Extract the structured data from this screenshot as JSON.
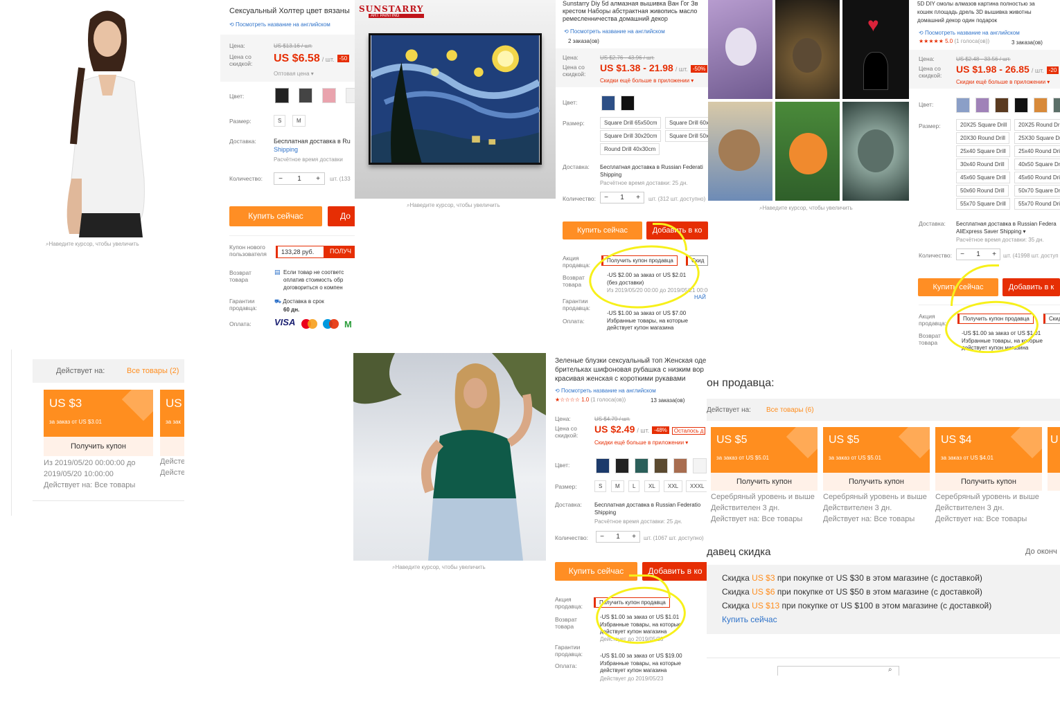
{
  "common": {
    "hover_hint": "Наведите курсор, чтобы увеличить",
    "translate_link": "Посмотреть название на английском",
    "price_label": "Цена:",
    "discount_price_label": "Цена со скидкой:",
    "color_label": "Цвет:",
    "size_label": "Размер:",
    "delivery_label": "Доставка:",
    "quantity_label": "Количество:",
    "buy_now": "Купить сейчас",
    "add_to_cart": "Добавить в ко",
    "seller_promo_label": "Акция продавца:",
    "return_label": "Возврат товара",
    "guarantee_label": "Гарантии продавца:",
    "payment_label": "Оплата:",
    "get_seller_coupon": "Получить купон продавца",
    "per_unit": "/ шт.",
    "qty_value": "1"
  },
  "panel1": {
    "title": "Сексуальный Холтер цвет вязаны",
    "old_price": "US $13.16 / шт.",
    "price": "US $6.58",
    "discount": "-50",
    "wholesale": "Оптовая цена ▾",
    "sizes": [
      "S",
      "M"
    ],
    "delivery": "Бесплатная доставка в Ru",
    "delivery_method": "Shipping",
    "delivery_time": "Расчётное время доставки",
    "stock": "шт. (133",
    "buy": "Купить сейчас",
    "cart": "До",
    "coupon_label": "Купон нового пользователя",
    "coupon_value": "133,28 руб.",
    "coupon_action": "ПОЛУЧ",
    "return_text": "Если товар не соответс оплатив стоимость обр договориться о компен",
    "guarantee_text": "Доставка в срок",
    "guarantee_days": "60 дн.",
    "payment_visa": "VISA"
  },
  "panel2": {
    "brand": "SUNSTARRY",
    "brand_sub": "ART PAINTING"
  },
  "panel3": {
    "title_line1": "Sunstarry Diy 5d алмазная вышивка Ван Гог Зв",
    "title_line2": "крестом Наборы абстрактная живопись масло",
    "title_line3": "ремесленничества домашний декор",
    "orders": "2 заказа(ов)",
    "old_price": "US $2.76 - 43.96 / шт.",
    "price": "US $1.38 - 21.98",
    "discount": "-50%",
    "app_discount": "Скидки ещё больше в приложении ▾",
    "sizes": [
      "Square Drill 65x50cm",
      "Square Drill 60x",
      "Square Drill 30x20cm",
      "Square Drill 50x",
      "Round Drill 40x30cm"
    ],
    "delivery": "Бесплатная доставка в Russian Federati",
    "delivery_method": "Shipping",
    "delivery_time": "Расчётное время доставки: 25 дн.",
    "stock": "шт. (312 шт. доступно)",
    "buy": "Купить сейчас",
    "cart": "Добавить в ко",
    "promo_tab2": "Скид",
    "coupon1_line1": "-US $2.00 за заказ от US $2.01",
    "coupon1_line2": "(без доставки)",
    "coupon1_line3": "Из 2019/05/20 00:00 до 2019/05/21 00:00",
    "coupon1_link": "НАЙ",
    "coupon2_line1": "-US $1.00 за заказ от US $7.00",
    "coupon2_line2": "Избранные товары, на которые",
    "coupon2_line3": "действует купон магазина"
  },
  "panel5": {
    "title_line1": "5D DIY смолы алмазов картина полностью за",
    "title_line2": "кошек площадь дрель 3D вышивка животны",
    "title_line3": "домашний декор один подарок",
    "rating": "★★★★★ 5.0",
    "votes": "(1 голоса(ов))",
    "orders": "3 заказа(ов)",
    "old_price": "US $2.48 - 33.56 / шт.",
    "price": "US $1.98 - 26.85",
    "discount": "-20",
    "app_discount": "Скидки ещё больше в приложении ▾",
    "sizes": [
      "20X25 Square Drill",
      "20X25 Round Dri",
      "20X30 Round Drill",
      "25X30 Square Dri",
      "25x40 Square Drill",
      "25x40 Round Dri",
      "30x40 Round Drill",
      "40x50 Square Dri",
      "45x60 Square Drill",
      "45x60 Round Dri",
      "50x60 Round Drill",
      "50x70 Square Dri",
      "55x70 Square Drill",
      "55x70 Round Dri"
    ],
    "delivery": "Бесплатная доставка в Russian Federa",
    "delivery_method": "AliExpress Saver Shipping ▾",
    "delivery_time": "Расчётное время доставки: 35 дн.",
    "stock": "шт. (41998 шт. доступ",
    "buy": "Купить сейчас",
    "cart": "Добавить в к",
    "promo_tab2": "Скид",
    "coupon_line1": "-US $1.00 за заказ от US $1.01",
    "coupon_line2": "Избранные товары, на которые",
    "coupon_line3": "действует купон магазина"
  },
  "panel6": {
    "applies_label": "Действует на:",
    "applies_value": "Все товары (2)",
    "coupon_amount": "US $3",
    "coupon_cond": "за заказ от US $3.01",
    "coupon_btn": "Получить купон",
    "coupon2_amount": "US",
    "coupon2_cond": "за зак",
    "meta1": "Из 2019/05/20 00:00:00 до",
    "meta2": "2019/05/20 10:00:00",
    "meta3": "Действует на: Все товары",
    "meta_side1": "Дейсте",
    "meta_side2": "Дейсте"
  },
  "panel7": {
    "title_line1": "Зеленые блузки сексуальный топ Женская оде",
    "title_line2": "брительках шифоновая рубашка с низким вор",
    "title_line3": "красивая женская с короткими рукавами",
    "rating": "★☆☆☆☆ 1.0",
    "votes": "(1 голоса(ов))",
    "orders": "13 заказа(ов)",
    "old_price": "US $4.79 / шт.",
    "price": "US $2.49",
    "discount": "-48%",
    "remaining": "Осталось д",
    "app_discount": "Скидки ещё больше в приложении ▾",
    "sizes": [
      "S",
      "M",
      "L",
      "XL",
      "XXL",
      "XXXL"
    ],
    "delivery": "Бесплатная доставка в Russian Federatio",
    "delivery_method": "Shipping",
    "delivery_time": "Расчётное время доставки: 25 дн.",
    "stock": "шт. (1067 шт. доступно)",
    "buy": "Купить сейчас",
    "cart": "Добавить в ко",
    "coupon1_line1": "-US $1.00 за заказ от US $1.01",
    "coupon1_line2": "Избранные товары, на которые",
    "coupon1_line3": "действует купон магазина",
    "coupon1_line4": "Действует до 2019/05/23",
    "coupon2_line1": "-US $1.00 за заказ от US $19.00",
    "coupon2_line2": "Избранные товары, на которые",
    "coupon2_line3": "действует купон магазина",
    "coupon2_line4": "Действует до 2019/05/23"
  },
  "panel8": {
    "heading": "он продавца:",
    "applies_label": "Действует на:",
    "applies_value": "Все товары (6)",
    "coupons": [
      {
        "amount": "US $5",
        "cond": "за заказ от US $5.01",
        "btn": "Получить купон",
        "meta1": "Серебряный уровень и выше",
        "meta2": "Действителен 3 дн.",
        "meta3": "Действует на: Все товары"
      },
      {
        "amount": "US $5",
        "cond": "за заказ от US $5.01",
        "btn": "Получить купон",
        "meta1": "Серебряный уровень и выше",
        "meta2": "Действителен 3 дн.",
        "meta3": "Действует на: Все товары"
      },
      {
        "amount": "US $4",
        "cond": "за заказ от US $4.01",
        "btn": "Получить купон",
        "meta1": "Серебряный уровень и выше",
        "meta2": "Действителен 3 дн.",
        "meta3": "Действует на: Все товары"
      }
    ],
    "discount_heading": "давец скидка",
    "until": "До оконч",
    "discounts": [
      {
        "pre": "Скидка",
        "amount": "US $3",
        "post": "при покупке от US $30 в этом магазине (с доставкой)"
      },
      {
        "pre": "Скидка",
        "amount": "US $6",
        "post": "при покупке от US $50 в этом магазине (с доставкой)"
      },
      {
        "pre": "Скидка",
        "amount": "US $13",
        "post": "при покупке от US $100 в этом магазине (с доставкой)"
      }
    ],
    "buy_link": "Купить сейчас"
  },
  "colors": {
    "accent_red": "#e62e04",
    "buy_orange": "#ff8e24",
    "coupon_orange": "#ff8e1f",
    "highlight_yellow": "#f7f01a",
    "link_blue": "#2e72c9"
  }
}
